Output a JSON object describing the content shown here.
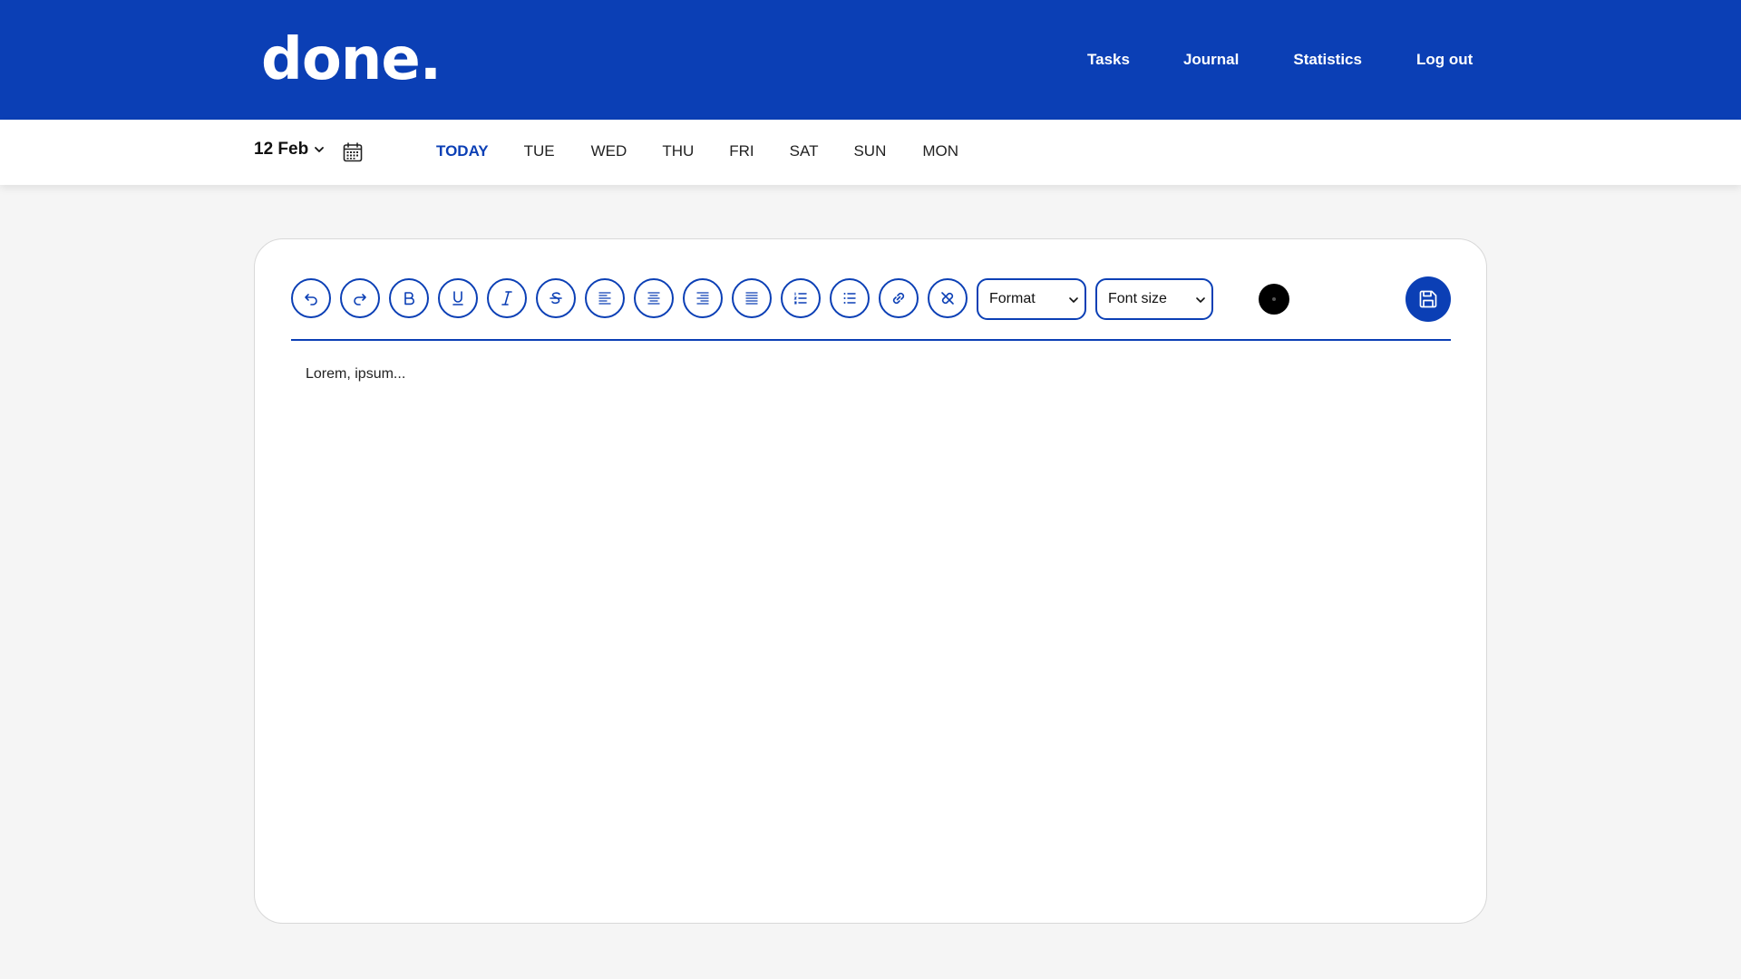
{
  "header": {
    "logo": "done.",
    "nav": [
      "Tasks",
      "Journal",
      "Statistics",
      "Log out"
    ]
  },
  "datebar": {
    "date": "12 Feb",
    "days": [
      "TODAY",
      "TUE",
      "WED",
      "THU",
      "FRI",
      "SAT",
      "SUN",
      "MON"
    ],
    "selected_day": "TODAY"
  },
  "toolbar": {
    "format_label": "Format",
    "font_size_label": "Font size",
    "current_color": "#000000"
  },
  "editor": {
    "content": "Lorem, ipsum..."
  },
  "colors": {
    "brand": "#0b3fb5",
    "background": "#f5f5f5",
    "card": "#ffffff"
  }
}
